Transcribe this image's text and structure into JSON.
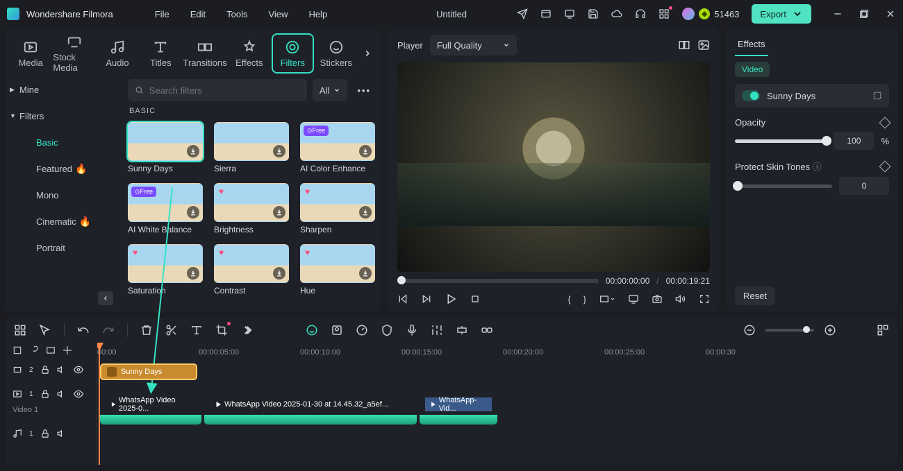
{
  "app": {
    "name": "Wondershare Filmora",
    "doc_title": "Untitled",
    "credits": "51463"
  },
  "menu": {
    "file": "File",
    "edit": "Edit",
    "tools": "Tools",
    "view": "View",
    "help": "Help"
  },
  "export": {
    "label": "Export"
  },
  "library": {
    "tabs": {
      "media": "Media",
      "stock": "Stock Media",
      "audio": "Audio",
      "titles": "Titles",
      "transitions": "Transitions",
      "effects": "Effects",
      "filters": "Filters",
      "stickers": "Stickers"
    },
    "side": {
      "mine": "Mine",
      "filters": "Filters",
      "basic": "Basic",
      "featured": "Featured",
      "mono": "Mono",
      "cinematic": "Cinematic",
      "portrait": "Portrait"
    },
    "search_placeholder": "Search filters",
    "all_label": "All",
    "section": "BASIC",
    "items": [
      {
        "name": "Sunny Days",
        "selected": true
      },
      {
        "name": "Sierra"
      },
      {
        "name": "AI Color Enhance",
        "tag": "Free"
      },
      {
        "name": "AI White Balance",
        "tag": "Free"
      },
      {
        "name": "Brightness",
        "heart": true
      },
      {
        "name": "Sharpen",
        "heart": true
      },
      {
        "name": "Saturation",
        "heart": true
      },
      {
        "name": "Contrast",
        "heart": true
      },
      {
        "name": "Hue",
        "heart": true
      }
    ]
  },
  "preview": {
    "label": "Player",
    "quality": "Full Quality",
    "time_current": "00:00:00:00",
    "time_sep": "/",
    "time_total": "00:00:19:21"
  },
  "effects": {
    "tab": "Effects",
    "chip": "Video",
    "filter_name": "Sunny Days",
    "opacity_label": "Opacity",
    "opacity_value": "100",
    "opacity_unit": "%",
    "protect_label": "Protect Skin Tones",
    "protect_value": "0",
    "reset": "Reset"
  },
  "timeline": {
    "ruler": [
      "00:00",
      "00:00:05:00",
      "00:00:10:00",
      "00:00:15:00",
      "00:00:20:00",
      "00:00:25:00",
      "00:00:30"
    ],
    "filter_clip": "Sunny Days",
    "vclips": [
      {
        "label": "WhatsApp Video 2025-0..."
      },
      {
        "label": "WhatsApp Video 2025-01-30 at 14.45.32_a5ef..."
      },
      {
        "label": "WhatsApp-Vid..."
      }
    ],
    "track_fx_count": "2",
    "track_v_count": "1",
    "track_v_label": "Video 1",
    "track_a_count": "1"
  }
}
